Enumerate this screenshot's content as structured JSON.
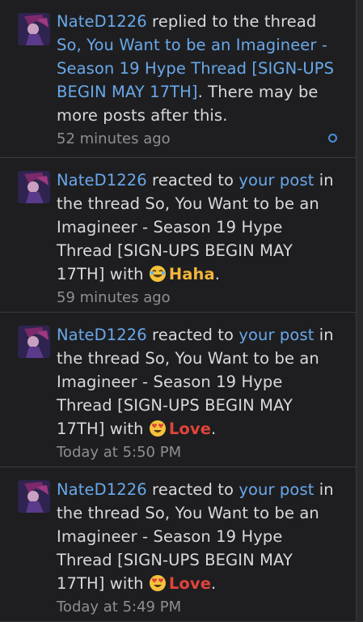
{
  "alerts": [
    {
      "user": "NateD1226",
      "action": " replied to the thread ",
      "thread": "So, You Want to be an Imagineer - Season 19 Hype Thread [SIGN-UPS BEGIN MAY 17TH]",
      "suffix": ". There may be more posts after this.",
      "time": "52 minutes ago"
    },
    {
      "user": "NateD1226",
      "action": " reacted to ",
      "post_link": "your post",
      "middle": " in the thread So, You Want to be an Imagineer - Season 19 Hype Thread [SIGN-UPS BEGIN MAY 17TH] with ",
      "reaction": "Haha",
      "end": ".",
      "time": "59 minutes ago"
    },
    {
      "user": "NateD1226",
      "action": " reacted to ",
      "post_link": "your post",
      "middle": " in the thread So, You Want to be an Imagineer - Season 19 Hype Thread [SIGN-UPS BEGIN MAY 17TH] with ",
      "reaction": "Love",
      "end": ".",
      "time": "Today at 5:50 PM"
    },
    {
      "user": "NateD1226",
      "action": " reacted to ",
      "post_link": "your post",
      "middle": " in the thread So, You Want to be an Imagineer - Season 19 Hype Thread [SIGN-UPS BEGIN MAY 17TH] with ",
      "reaction": "Love",
      "end": ".",
      "time": "Today at 5:49 PM"
    }
  ],
  "icons": {
    "avatar": "user-avatar-icon",
    "haha": "laughing-emoji-icon",
    "love": "heart-eyes-emoji-icon",
    "unread": "mark-read-circle-icon"
  },
  "colors": {
    "background": "#1e1e20",
    "link": "#69a8ea",
    "text": "#d9d9db",
    "muted": "#8e8e93",
    "haha": "#f2b53b",
    "love": "#e0443a",
    "divider": "#3a3a3c"
  }
}
